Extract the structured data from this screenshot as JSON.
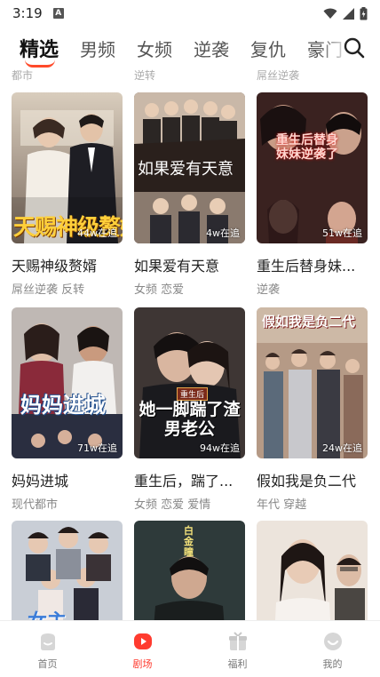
{
  "status_bar": {
    "time": "3:19",
    "notification_letter": "A"
  },
  "tabs": [
    {
      "label": "精选",
      "active": true
    },
    {
      "label": "男频"
    },
    {
      "label": "女频"
    },
    {
      "label": "逆袭"
    },
    {
      "label": "复仇"
    },
    {
      "label": "豪门"
    }
  ],
  "previous_row_tags": [
    "都市",
    "逆转",
    "屌丝逆袭"
  ],
  "cards": [
    {
      "title": "天赐神级赘婿",
      "tags": "屌丝逆袭 反转",
      "count": "44w在追",
      "poster_text": "天赐神级赘婿"
    },
    {
      "title": "如果爱有天意",
      "tags": "女频 恋爱",
      "count": "4w在追",
      "poster_text": "如果爱有天意"
    },
    {
      "title": "重生后替身妹...",
      "tags": "逆袭",
      "count": "51w在追",
      "poster_text": "重生后替身妹妹逆袭了"
    },
    {
      "title": "妈妈进城",
      "tags": "现代都市",
      "count": "71w在追",
      "poster_text": "妈妈进城"
    },
    {
      "title": "重生后，踹了...",
      "tags": "女频 恋爱 爱情",
      "count": "94w在追",
      "poster_text": "她一脚踹了渣男老公",
      "poster_tag": "重生后"
    },
    {
      "title": "假如我是负二代",
      "tags": "年代 穿越",
      "count": "24w在追",
      "poster_text": "假如我是负二代"
    },
    {
      "title": "",
      "tags": "",
      "count": "",
      "poster_text": "女主"
    },
    {
      "title": "",
      "tags": "",
      "count": "",
      "poster_text": "白金瞳"
    },
    {
      "title": "",
      "tags": "",
      "count": "",
      "poster_text": ""
    }
  ],
  "bottom_nav": [
    {
      "label": "首页",
      "icon": "home-icon"
    },
    {
      "label": "剧场",
      "icon": "theater-play-icon",
      "active": true
    },
    {
      "label": "福利",
      "icon": "gift-icon"
    },
    {
      "label": "我的",
      "icon": "profile-icon"
    }
  ],
  "colors": {
    "accent": "#ff3b2f",
    "text_primary": "#222222",
    "text_secondary": "#888888"
  }
}
